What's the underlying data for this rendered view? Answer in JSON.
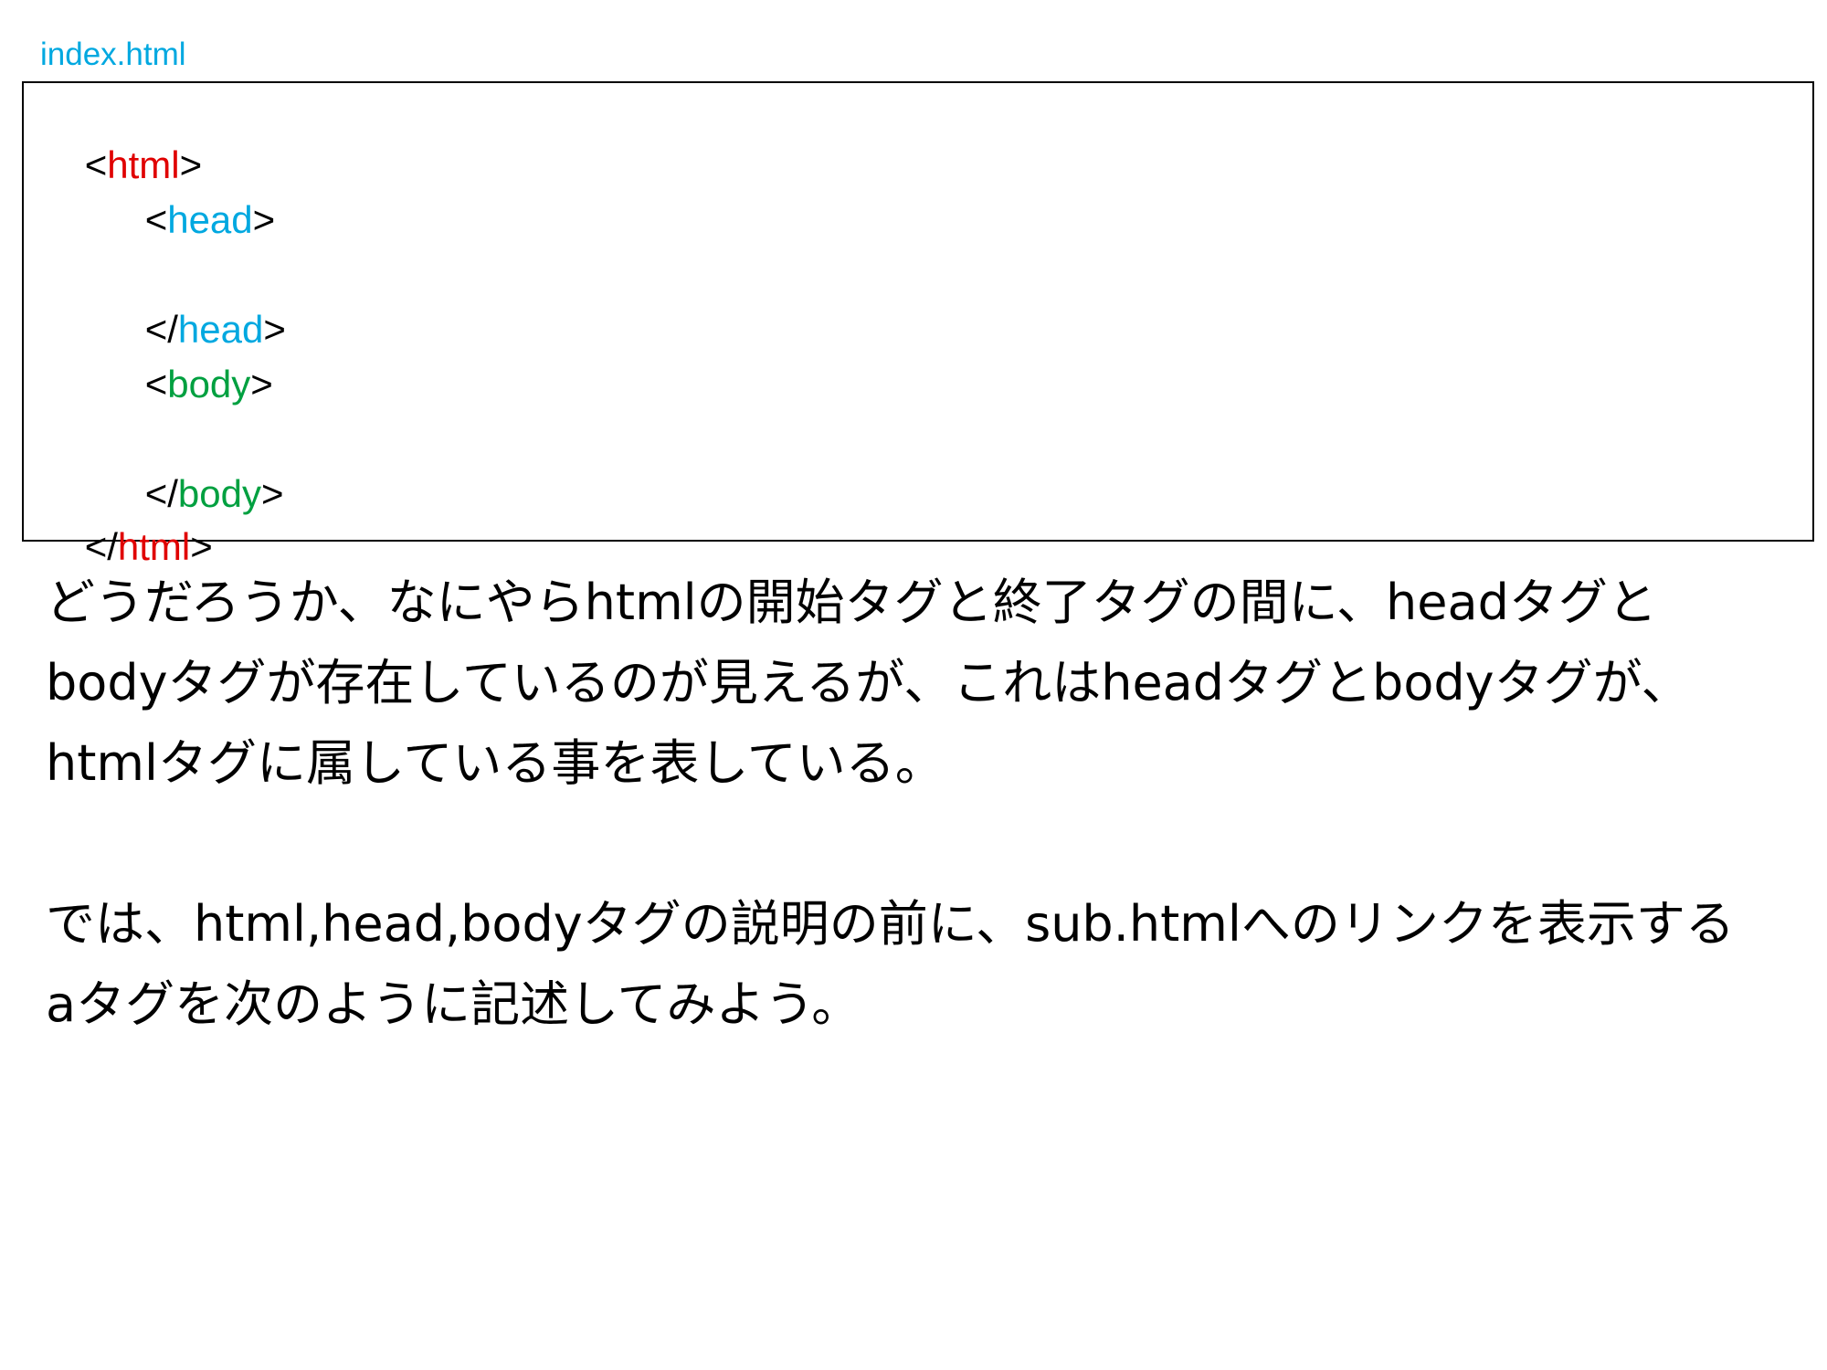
{
  "filename": "index.html",
  "code": {
    "lines": [
      {
        "open": "<",
        "tag": "html",
        "close": ">",
        "kind": "html",
        "indent": false
      },
      {
        "open": "<",
        "tag": "head",
        "close": ">",
        "kind": "head",
        "indent": true
      },
      {
        "open": "",
        "tag": "",
        "close": "",
        "kind": "blank",
        "indent": true
      },
      {
        "open": "</",
        "tag": "head",
        "close": ">",
        "kind": "head",
        "indent": true
      },
      {
        "open": "<",
        "tag": "body",
        "close": ">",
        "kind": "body",
        "indent": true
      },
      {
        "open": "",
        "tag": "",
        "close": "",
        "kind": "blank",
        "indent": true
      },
      {
        "open": "</",
        "tag": "body",
        "close": ">",
        "kind": "body",
        "indent": true
      },
      {
        "open": "</",
        "tag": "html",
        "close": ">",
        "kind": "html",
        "indent": false
      }
    ]
  },
  "paragraph1": {
    "lines": [
      "どうだろうか、なにやらhtmlの開始タグと終了タグの間に、headタグと",
      "bodyタグが存在しているのが見えるが、これはheadタグとbodyタグが、",
      "htmlタグに属している事を表している。"
    ]
  },
  "paragraph2": {
    "lines": [
      "では、html,head,bodyタグの説明の前に、sub.htmlへのリンクを表示する",
      "aタグを次のように記述してみよう。"
    ]
  },
  "colors": {
    "html_tag": "#e00000",
    "head_tag": "#00a8e0",
    "body_tag": "#00a040",
    "filename": "#00a8e0"
  }
}
